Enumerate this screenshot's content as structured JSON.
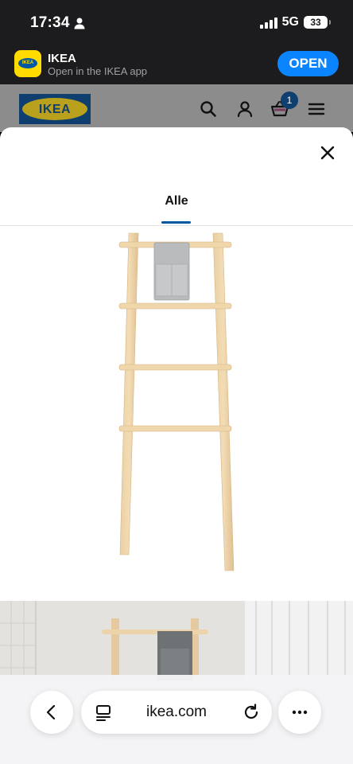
{
  "status_bar": {
    "time": "17:34",
    "network": "5G",
    "battery": "33"
  },
  "app_banner": {
    "app_name": "IKEA",
    "subtitle": "Open in the IKEA app",
    "open_label": "OPEN",
    "accent_color": "#0a84ff"
  },
  "header": {
    "logo_text": "IKEA",
    "cart_count": "1",
    "icons": [
      "search-icon",
      "user-icon",
      "cart-icon",
      "menu-icon"
    ]
  },
  "modal": {
    "tabs": [
      {
        "label": "Alle",
        "selected": true
      }
    ],
    "images": [
      "product-image",
      "lifestyle-image"
    ]
  },
  "browser": {
    "url": "ikea.com",
    "icons": [
      "back-icon",
      "tab-menu-icon",
      "reload-icon",
      "more-icon"
    ]
  }
}
